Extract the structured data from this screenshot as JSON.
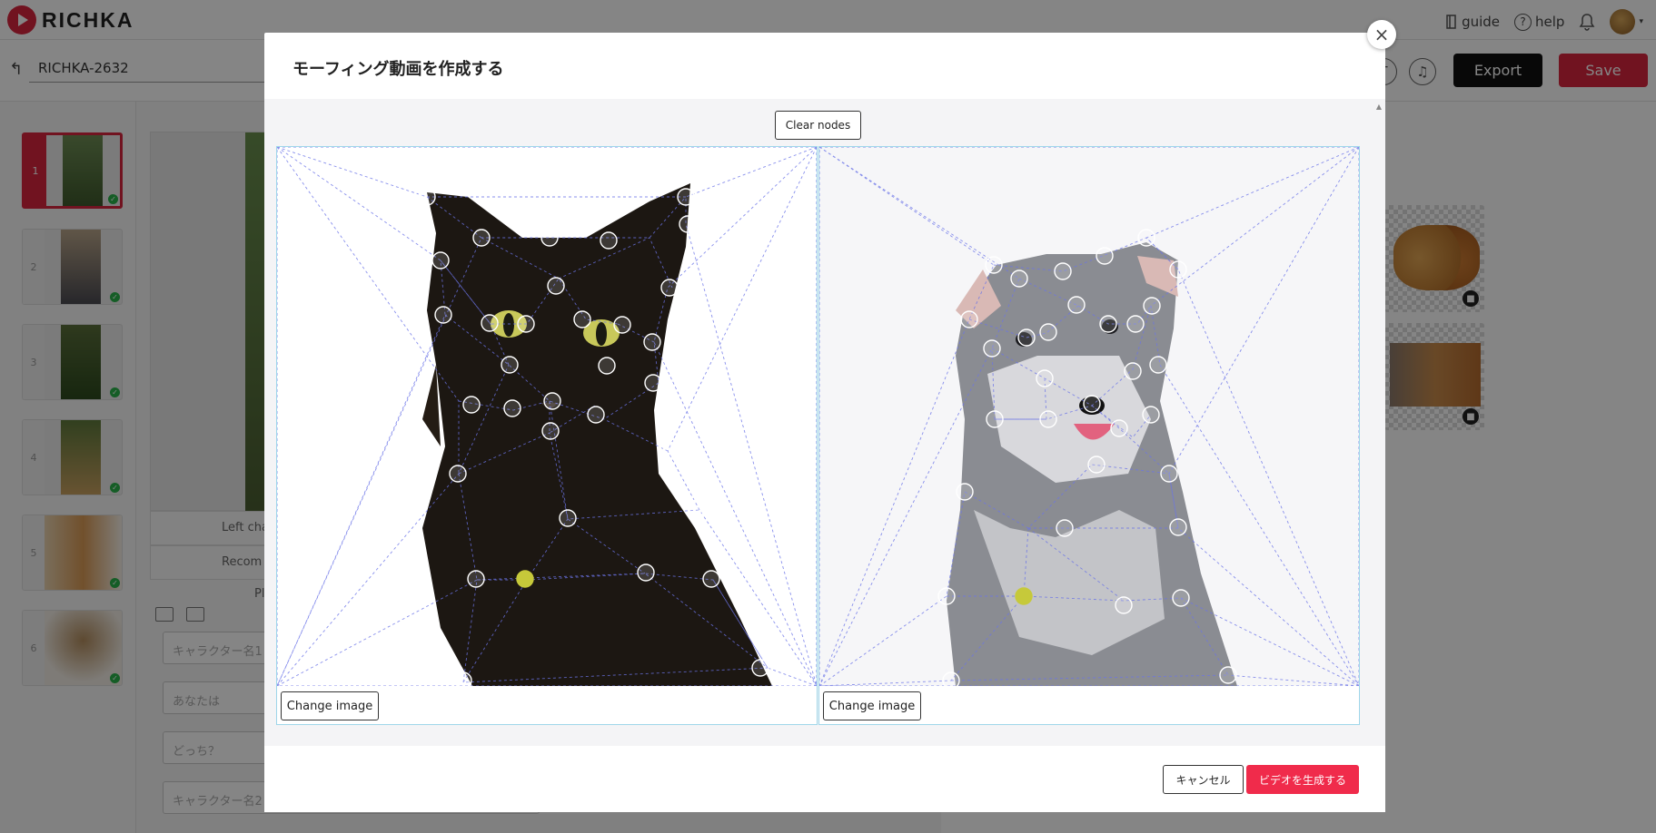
{
  "app": {
    "brand": "RICHKA",
    "nav": {
      "guide": "guide",
      "help": "help"
    },
    "project_name": "RICHKA-2632",
    "export_label": "Export",
    "save_label": "Save"
  },
  "slides": [
    {
      "number": "1",
      "active": true
    },
    {
      "number": "2",
      "active": false
    },
    {
      "number": "3",
      "active": false
    },
    {
      "number": "4",
      "active": false
    },
    {
      "number": "5",
      "active": false
    },
    {
      "number": "6",
      "active": false
    }
  ],
  "editor": {
    "caption_left": "Left char",
    "caption_recom": "Recom",
    "caption_pl": "Pl",
    "fields": [
      "キャラクター名1",
      "あなたは",
      "どっち？",
      "キャラクター名2"
    ]
  },
  "modal": {
    "title": "モーフィング動画を作成する",
    "close_symbol": "×",
    "clear_nodes_label": "Clear nodes",
    "left_change_label": "Change image",
    "right_change_label": "Change image",
    "cancel_label": "キャンセル",
    "generate_label": "ビデオを生成する"
  },
  "colors": {
    "brand_red": "#d8263f",
    "generate_red": "#f02b4b",
    "node_active": "#c6c93a",
    "mesh_line": "#6b74e8"
  },
  "icons": {
    "close": "close-icon",
    "back": "back-arrow-icon",
    "bell": "bell-icon",
    "help": "help-circle-icon",
    "guide": "book-icon",
    "music": "music-note-icon",
    "trash": "trash-icon",
    "check": "check-icon"
  }
}
